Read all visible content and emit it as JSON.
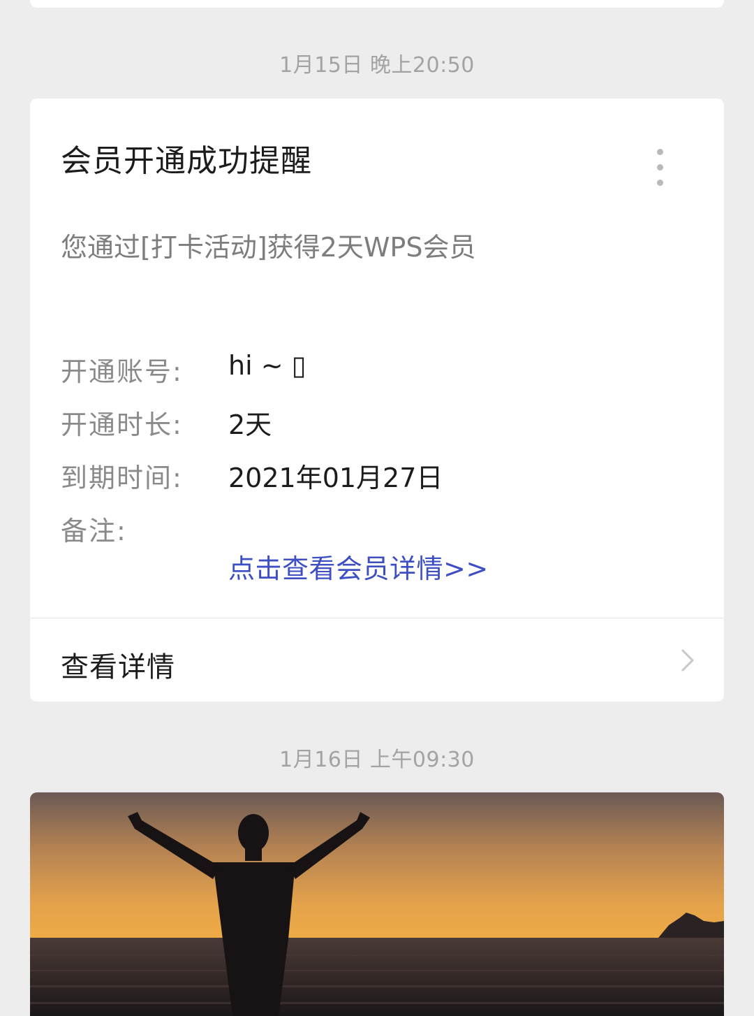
{
  "messages": [
    {
      "timestamp": "1月15日 晚上20:50",
      "title": "会员开通成功提醒",
      "description": "您通过[打卡活动]获得2天WPS会员",
      "fields": [
        {
          "label": "开通账号:",
          "value": "hi ~ ▯"
        },
        {
          "label": "开通时长:",
          "value": "2天"
        },
        {
          "label": "到期时间:",
          "value": "2021年01月27日"
        },
        {
          "label": "备注:",
          "value": ""
        }
      ],
      "link_text": "点击查看会员详情>>",
      "details_label": "查看详情",
      "link_color": "#3d4fc2"
    },
    {
      "timestamp": "1月16日 上午09:30"
    }
  ],
  "icons": [
    "more-vertical-icon",
    "chevron-right-icon"
  ],
  "colors": {
    "background": "#ededed",
    "card": "#ffffff",
    "timestamp_text": "#a3a3a3",
    "label_text": "#8a8a8a",
    "value_text": "#1c1c1c"
  }
}
